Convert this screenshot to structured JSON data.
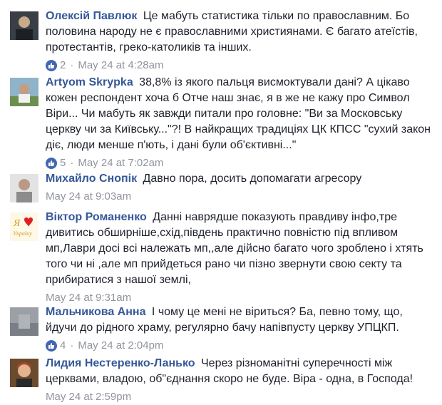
{
  "comments": [
    {
      "author": "Олексій Павлюк",
      "text": "Це мабуть статистика тільки по православним. Бо половина народу не є православними християнами. Є багато атеїстів, протестантів, греко-католиків та інших.",
      "likes": "2",
      "time": "May 24 at 4:28am",
      "avatar_icon": "user-photo-icon"
    },
    {
      "author": "Artyom Skrypka",
      "text": "38,8% із якого пальця висмоктували дані? А цікаво кожен респондент хоча б Отче наш знає, я в же не кажу про Символ Віри... Чи мабуть як завжди питали про головне: \"Ви за Московську церкву чи за Київську...\"?! В найкращих традиціях ЦК КПСС \"сухий закон діє, люди менше п'ють, і дані були об'єктивні...\"",
      "likes": "5",
      "time": "May 24 at 7:02am",
      "avatar_icon": "user-photo-icon"
    },
    {
      "author": "Михайло Снопік",
      "text": "Давно пора, досить допомагати агресору",
      "likes": "",
      "time": "May 24 at 9:03am",
      "avatar_icon": "user-photo-icon"
    },
    {
      "author": "Віктор Романенко",
      "text": "Данні наврядше показують правдиву інфо,тре дивитись обширніше,схід,південь практично повністю під впливом мп,Лаври досі всі належать мп,,але дійсно багато чого зроблено і хтять того чи ні ,але мп прийдеться рано чи пізно звернути свою секту та прибиратися з нашої землі,",
      "likes": "",
      "time": "May 24 at 9:31am",
      "avatar_icon": "heart-ukraine-icon",
      "avatar_text": "Я ♥ Україну"
    },
    {
      "author": "Мальчикова Анна",
      "text": "І чому це мені не віриться? Ба, певно тому, що, йдучи до рідного храму, регулярно бачу напівпусту церкву УПЦКП.",
      "likes": "4",
      "time": "May 24 at 2:04pm",
      "avatar_icon": "user-photo-icon"
    },
    {
      "author": "Лидия Нестеренко-Ланько",
      "text": "Через різноманітні суперечності між церквами, владою, об\"єднання скоро не буде. Віра - одна, в Господа!",
      "likes": "",
      "time": "May 24 at 2:59pm",
      "avatar_icon": "user-photo-icon"
    }
  ],
  "colors": {
    "author": "#365899",
    "meta": "#90949c",
    "like_badge": "#4267b2"
  }
}
